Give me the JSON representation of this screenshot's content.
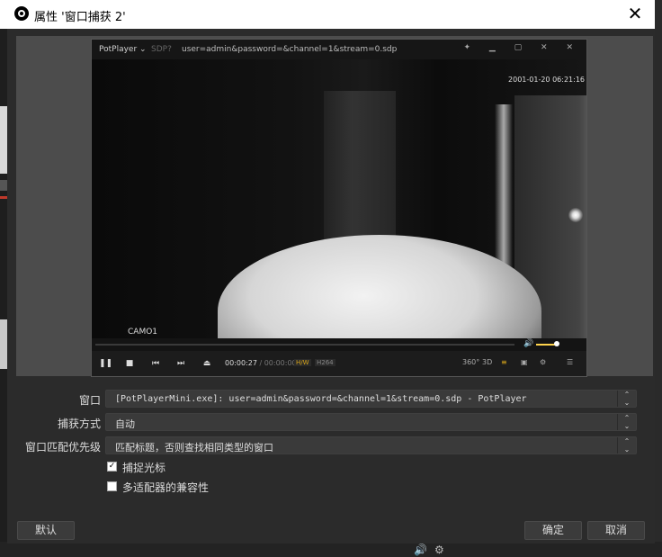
{
  "window": {
    "title": "属性 '窗口捕获 2'",
    "close_glyph": "✕"
  },
  "player": {
    "brand": "PotPlayer ⌄",
    "sdp_label": "SDP?",
    "url": "user=admin&password=&channel=1&stream=0.sdp",
    "window_buttons": "✦ ▁ ▢ ✕ ✕",
    "timestamp": "2001-01-20 06:21:16",
    "camera_label": "CAMO1",
    "time_current": "00:00:27",
    "time_sep": " / ",
    "time_total": "00:00:00",
    "hw_badge": "H/W",
    "codec_badge": "H264",
    "icons": {
      "pause": "❚❚",
      "stop": "■",
      "prev": "⏮",
      "next": "⏭",
      "eject": "⏏",
      "vr": "360°",
      "three_d": "3D",
      "eq": "≡",
      "sub": "▣",
      "settings": "⚙",
      "menu": "☰",
      "volume": "🔊"
    }
  },
  "form": {
    "window": {
      "label": "窗口",
      "value": "[PotPlayerMini.exe]: user=admin&password=&channel=1&stream=0.sdp - PotPlayer"
    },
    "capture_method": {
      "label": "捕获方式",
      "value": "自动"
    },
    "match_priority": {
      "label": "窗口匹配优先级",
      "value": "匹配标题，否则查找相同类型的窗口"
    },
    "capture_cursor": {
      "label": "捕捉光标",
      "checked": true,
      "mark": "✓"
    },
    "multi_adapter": {
      "label": "多适配器的兼容性",
      "checked": false,
      "mark": ""
    },
    "arrow_glyph": "⌃\n⌄"
  },
  "buttons": {
    "defaults": "默认",
    "ok": "确定",
    "cancel": "取消"
  },
  "colors": {
    "dialog_bg": "#2b2b2b",
    "field_bg": "#3a3a3a",
    "titlebar_bg": "#ffffff",
    "hw_accent": "#d9a61a"
  }
}
